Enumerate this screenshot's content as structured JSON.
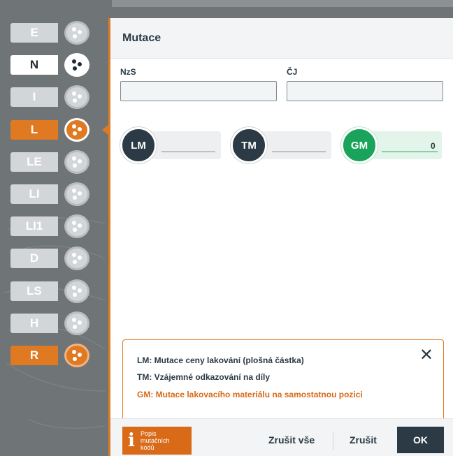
{
  "sidebar": {
    "tabs": [
      {
        "label": "E",
        "state": "normal"
      },
      {
        "label": "N",
        "state": "active"
      },
      {
        "label": "I",
        "state": "normal"
      },
      {
        "label": "L",
        "state": "selected"
      },
      {
        "label": "LE",
        "state": "normal"
      },
      {
        "label": "LI",
        "state": "normal"
      },
      {
        "label": "LI1",
        "state": "normal"
      },
      {
        "label": "D",
        "state": "normal"
      },
      {
        "label": "LS",
        "state": "normal"
      },
      {
        "label": "H",
        "state": "normal"
      },
      {
        "label": "R",
        "state": "orange"
      }
    ],
    "tab_icon": "mutation-dots-icon"
  },
  "panel": {
    "title": "Mutace",
    "fields": {
      "nzs_label": "NzS",
      "nzs_value": "",
      "cj_label": "ČJ",
      "cj_value": ""
    },
    "mutations": [
      {
        "code": "LM",
        "value": "",
        "color": "#2b3a44"
      },
      {
        "code": "TM",
        "value": "",
        "color": "#2b3a44"
      },
      {
        "code": "GM",
        "value": "0",
        "color": "#1aa35a"
      }
    ]
  },
  "info": {
    "lines": [
      {
        "text": "LM: Mutace ceny lakování (plošná částka)",
        "color": "#2b3a44"
      },
      {
        "text": "TM: Vzájemné odkazování na díly",
        "color": "#2b3a44"
      },
      {
        "text": "GM: Mutace lakovacího materiálu na samostatnou pozici",
        "color": "#d86a18"
      }
    ],
    "close_icon": "close-icon"
  },
  "footer": {
    "info_button": {
      "icon": "info-icon",
      "lines": [
        "Popis",
        "mutačních",
        "kódů"
      ]
    },
    "cancel_all_label": "Zrušit vše",
    "cancel_label": "Zrušit",
    "ok_label": "OK"
  }
}
